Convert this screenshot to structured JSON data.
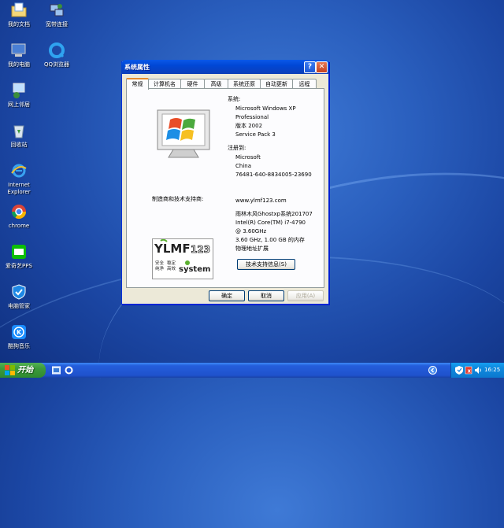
{
  "desktop": {
    "icons": [
      {
        "label": "我的文档",
        "icon": "folder-documents-icon"
      },
      {
        "label": "宽带连接",
        "icon": "network-connection-icon"
      },
      {
        "label": "我的电脑",
        "icon": "computer-icon"
      },
      {
        "label": "QQ浏览器",
        "icon": "qq-browser-icon"
      },
      {
        "label": "网上邻居",
        "icon": "network-places-icon"
      },
      {
        "label": "回收站",
        "icon": "recycle-bin-icon"
      },
      {
        "label_line1": "Internet",
        "label_line2": "Explorer",
        "icon": "internet-explorer-icon"
      },
      {
        "label": "chrome",
        "icon": "chrome-icon"
      },
      {
        "label": "爱奇艺PPS",
        "icon": "iqiyi-icon"
      },
      {
        "label": "电脑管家",
        "icon": "pc-manager-icon"
      },
      {
        "label": "酷狗音乐",
        "icon": "kugou-music-icon"
      }
    ]
  },
  "dialog": {
    "title": "系统属性",
    "help_glyph": "?",
    "close_glyph": "✕",
    "tabs": [
      "常规",
      "计算机名",
      "硬件",
      "高级",
      "系统还原",
      "自动更新",
      "远程"
    ],
    "system_label": "系统:",
    "system_lines": [
      "Microsoft Windows XP",
      "Professional",
      "版本 2002",
      "Service Pack 3"
    ],
    "registered_label": "注册到:",
    "registered_lines": [
      "Microsoft",
      "China",
      "76481-640-8834005-23690"
    ],
    "manufacturer_label": "制造商和技术支持商:",
    "website": "www.ylmf123.com",
    "hardware_lines": [
      "雨林木风Ghostxp系统201707",
      "Intel(R) Core(TM) i7-4790",
      "@ 3.60GHz",
      "3.60 GHz, 1.00 GB 的内存",
      "物理地址扩展"
    ],
    "support_button": "技术支持信息(S)",
    "logo": {
      "brand": "YLMF",
      "number": "123",
      "cn1": "安全",
      "cn2": "稳定",
      "cn3": "纯净",
      "cn4": "高效",
      "word": "system"
    },
    "ok_button": "确定",
    "cancel_button": "取消",
    "apply_button": "应用(A)"
  },
  "taskbar": {
    "start_label": "开始",
    "clock": "16:25"
  }
}
